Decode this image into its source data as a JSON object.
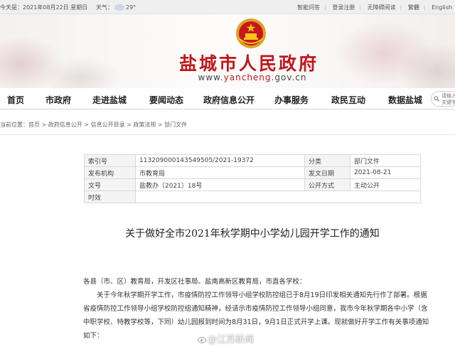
{
  "topbar": {
    "date_text": "今天是：2021年08月22日 星期日",
    "weather_label": "天气：",
    "weather_temp": "29°",
    "links": [
      "智能问答",
      "登录注册",
      "无障碍阅读",
      "繁體",
      "English"
    ]
  },
  "header": {
    "title": "盐城市人民政府",
    "url_prefix": "www.",
    "url_brand": "yancheng",
    "url_suffix": ".gov.cn"
  },
  "nav": {
    "items": [
      "首页",
      "市政府",
      "走进盐城",
      "要闻动态",
      "政府信息公开",
      "办事服务",
      "政民互动",
      "数据盐城"
    ],
    "search_placeholder": "请输入关键字"
  },
  "breadcrumb": {
    "text": "当前位置：首页 > 政府信息公开 > 信息公开目录 > 政策法规 > 部门文件"
  },
  "meta": {
    "rows": [
      {
        "label": "索引号",
        "value": "113209000143549505/2021-19372",
        "label2": "分类",
        "value2": "部门文件"
      },
      {
        "label": "发布机构",
        "value": "市教育局",
        "label2": "发文日期",
        "value2": "2021-08-21"
      },
      {
        "label": "文号",
        "value": "盐教办〔2021〕18号",
        "label2": "公开方式",
        "value2": "主动公开"
      },
      {
        "label": "时效",
        "value": "",
        "label2": "",
        "value2": ""
      }
    ]
  },
  "document": {
    "title": "关于做好全市2021年秋学期中小学幼儿园开学工作的通知",
    "salutation": "各县（市、区）教育局，开发区社事局、盐南高新区教育局，市直各学校：",
    "paragraph": "关于今年秋学期开学工作，市疫情防控工作领导小组学校防控组已于8月19日印发相关通知先行作了部署。根据省疫情防控工作领导小组学校防控组通知精神，经请示市疫情防控工作领导小组同意，我市今年秋学期各中小学（含中职学校、特教学校等，下同）幼儿园报到时间为8月31日，9月1日正式开学上课。现就做好开学工作有关事项通知如下："
  },
  "watermark": {
    "text": "@江苏新闻"
  },
  "colors": {
    "brand_red": "#c0171c",
    "topbar_bg": "#efefef"
  }
}
